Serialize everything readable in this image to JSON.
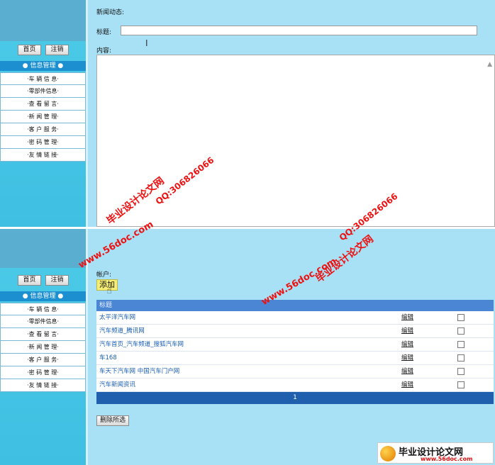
{
  "nav": {
    "home_label": "首页",
    "logout_label": "注销"
  },
  "menu": {
    "header": "● 信息管理 ●",
    "items": [
      "·车 辆 信 息·",
      "·零部件信息·",
      "·查 看 留 言·",
      "·新 闻 管 理·",
      "·客 户 服 务·",
      "·密 码 管 理·",
      "·友 情 链 接·"
    ]
  },
  "top_form": {
    "section_label": "新闻动态:",
    "title_label": "标题:",
    "title_value": "",
    "content_label": "内容:"
  },
  "bottom": {
    "account_label": "帐户:",
    "add_label": "添加",
    "table_header": "标题",
    "rows": [
      {
        "title": "太平洋汽车网",
        "edit": "编辑"
      },
      {
        "title": "汽车频道_腾讯网",
        "edit": "编辑"
      },
      {
        "title": "汽车首页_汽车频道_搜狐汽车网",
        "edit": "编辑"
      },
      {
        "title": "车168",
        "edit": "编辑"
      },
      {
        "title": "车天下汽车网 中国汽车门户网",
        "edit": "编辑"
      },
      {
        "title": "汽车新闻资讯",
        "edit": "编辑"
      }
    ],
    "page": "1",
    "delete_label": "删除所选"
  },
  "watermarks": {
    "cn": "毕业设计论文网",
    "url": "www.56doc.com",
    "qq": "QQ:306826066"
  },
  "logo": {
    "name": "毕业设计论文网",
    "url": "www.56doc.com"
  },
  "colors": {
    "sidebar": "#4ccbe8",
    "main_bg": "#a8e0f5",
    "menu_header": "#1b8fd0",
    "table_header": "#4b86d4",
    "pager": "#1f5fad",
    "watermark": "#e11111"
  }
}
